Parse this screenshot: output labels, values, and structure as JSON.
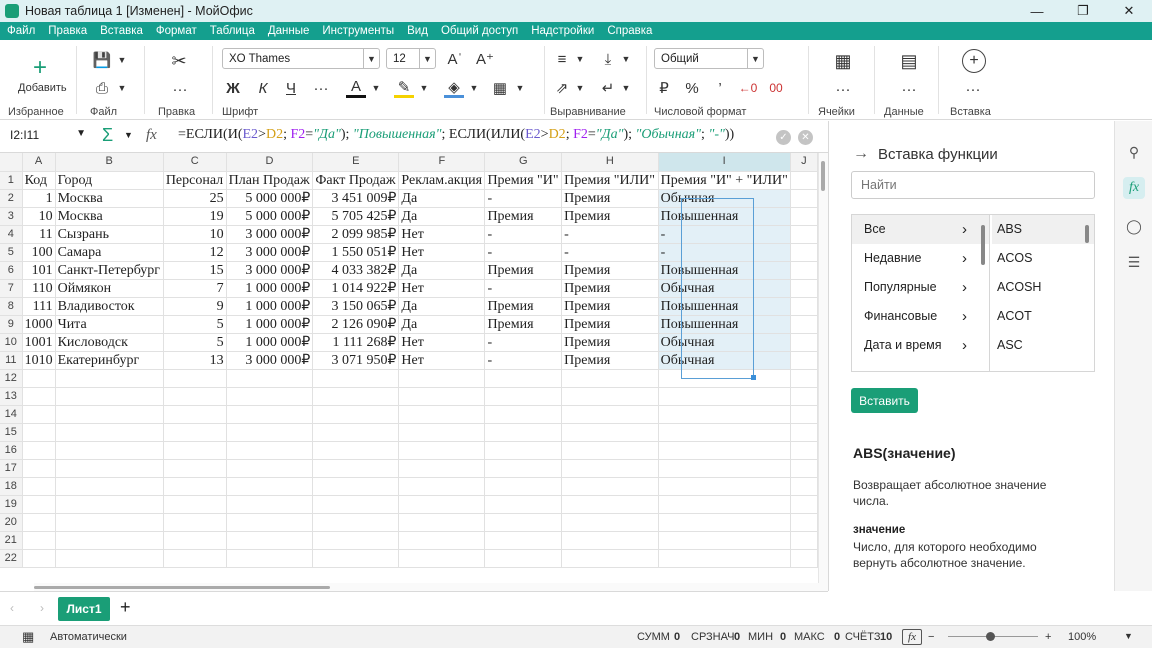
{
  "window": {
    "title": "Новая таблица 1 [Изменен] - МойОфис"
  },
  "menu": [
    "Файл",
    "Правка",
    "Вставка",
    "Формат",
    "Таблица",
    "Данные",
    "Инструменты",
    "Вид",
    "Общий доступ",
    "Надстройки",
    "Справка"
  ],
  "ribbon": {
    "add_label": "Добавить",
    "groups": {
      "favorites": "Избранное",
      "file": "Файл",
      "edit": "Правка",
      "font": "Шрифт",
      "align": "Выравнивание",
      "numfmt": "Числовой формат",
      "cells": "Ячейки",
      "data": "Данные",
      "insert": "Вставка"
    },
    "font_name": "XO Thames",
    "font_size": "12",
    "number_format": "Общий"
  },
  "formula_bar": {
    "name_box": "I2:I11",
    "formula_parts": [
      {
        "t": "=ЕСЛИ(И(",
        "c": ""
      },
      {
        "t": "E2",
        "c": "r1"
      },
      {
        "t": ">",
        "c": ""
      },
      {
        "t": "D2",
        "c": "r2"
      },
      {
        "t": "; ",
        "c": ""
      },
      {
        "t": "F2",
        "c": "r3"
      },
      {
        "t": "=",
        "c": ""
      },
      {
        "t": "\"Да\"",
        "c": "str"
      },
      {
        "t": "); ",
        "c": ""
      },
      {
        "t": "\"Повышенная\"",
        "c": "str"
      },
      {
        "t": "; ЕСЛИ(ИЛИ(",
        "c": ""
      },
      {
        "t": "E2",
        "c": "r1"
      },
      {
        "t": ">",
        "c": ""
      },
      {
        "t": "D2",
        "c": "r2"
      },
      {
        "t": "; ",
        "c": ""
      },
      {
        "t": "F2",
        "c": "r3"
      },
      {
        "t": "=",
        "c": ""
      },
      {
        "t": "\"Да\"",
        "c": "str"
      },
      {
        "t": "); ",
        "c": ""
      },
      {
        "t": "\"Обычная\"",
        "c": "str"
      },
      {
        "t": "; ",
        "c": ""
      },
      {
        "t": "\"-\"",
        "c": "str"
      },
      {
        "t": "))",
        "c": ""
      }
    ]
  },
  "sheet": {
    "columns": [
      "A",
      "B",
      "C",
      "D",
      "E",
      "F",
      "G",
      "H",
      "I",
      "J"
    ],
    "rows": [
      [
        "Код",
        "Город",
        "Персонал",
        "План Продаж",
        "Факт Продаж",
        "Реклам.акция",
        "Премия \"И\"",
        "Премия \"ИЛИ\"",
        "Премия \"И\" + \"ИЛИ\"",
        ""
      ],
      [
        "1",
        "Москва",
        "25",
        "5 000 000₽",
        "3 451 009₽",
        "Да",
        "-",
        "Премия",
        "Обычная",
        ""
      ],
      [
        "10",
        "Москва",
        "19",
        "5 000 000₽",
        "5 705 425₽",
        "Да",
        "Премия",
        "Премия",
        "Повышенная",
        ""
      ],
      [
        "11",
        "Сызрань",
        "10",
        "3 000 000₽",
        "2 099 985₽",
        "Нет",
        "-",
        "-",
        "-",
        ""
      ],
      [
        "100",
        "Самара",
        "12",
        "3 000 000₽",
        "1 550 051₽",
        "Нет",
        "-",
        "-",
        "-",
        ""
      ],
      [
        "101",
        "Санкт-Петербург",
        "15",
        "3 000 000₽",
        "4 033 382₽",
        "Да",
        "Премия",
        "Премия",
        "Повышенная",
        ""
      ],
      [
        "110",
        "Оймякон",
        "7",
        "1 000 000₽",
        "1 014 922₽",
        "Нет",
        "-",
        "Премия",
        "Обычная",
        ""
      ],
      [
        "111",
        "Владивосток",
        "9",
        "1 000 000₽",
        "3 150 065₽",
        "Да",
        "Премия",
        "Премия",
        "Повышенная",
        ""
      ],
      [
        "1000",
        "Чита",
        "5",
        "1 000 000₽",
        "2 126 090₽",
        "Да",
        "Премия",
        "Премия",
        "Повышенная",
        ""
      ],
      [
        "1001",
        "Кисловодск",
        "5",
        "1 000 000₽",
        "1 111 268₽",
        "Нет",
        "-",
        "Премия",
        "Обычная",
        ""
      ],
      [
        "1010",
        "Екатеринбург",
        "13",
        "3 000 000₽",
        "3 071 950₽",
        "Нет",
        "-",
        "Премия",
        "Обычная",
        ""
      ]
    ],
    "row_count": 22,
    "tab": "Лист1"
  },
  "sidebar": {
    "title": "Вставка функции",
    "search_placeholder": "Найти",
    "categories": [
      "Все",
      "Недавние",
      "Популярные",
      "Финансовые",
      "Дата и время"
    ],
    "functions": [
      "ABS",
      "ACOS",
      "ACOSH",
      "ACOT",
      "ASC"
    ],
    "insert_button": "Вставить",
    "fn_signature": "ABS(значение)",
    "fn_description": "Возвращает абсолютное значение числа.",
    "param_name": "значение",
    "param_description": "Число, для которого необходимо вернуть абсолютное значение."
  },
  "status": {
    "mode": "Автоматически",
    "sum_label": "СУММ",
    "sum": "0",
    "avg_label": "СРЗНАЧ",
    "avg": "0",
    "min_label": "МИН",
    "min": "0",
    "max_label": "МАКС",
    "max": "0",
    "count_label": "СЧЁТЗ",
    "count": "10",
    "zoom": "100%"
  }
}
